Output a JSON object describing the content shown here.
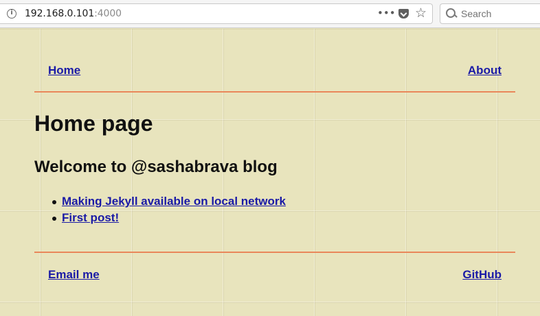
{
  "browser": {
    "url_host": "192.168.0.101",
    "url_port": ":4000",
    "search_placeholder": "Search",
    "icons": [
      "info-icon",
      "more-icon",
      "pocket-icon",
      "star-icon",
      "search-icon"
    ]
  },
  "nav": {
    "home_label": "Home",
    "about_label": "About"
  },
  "main": {
    "title": "Home page",
    "subtitle": "Welcome to @sashabrava blog",
    "posts": [
      {
        "title": "Making Jekyll available on local network"
      },
      {
        "title": "First post!"
      }
    ]
  },
  "footer": {
    "email_label": "Email me",
    "github_label": "GitHub"
  },
  "colors": {
    "background": "#e8e4bd",
    "link": "#1a1aa6",
    "divider": "#e9875a"
  }
}
